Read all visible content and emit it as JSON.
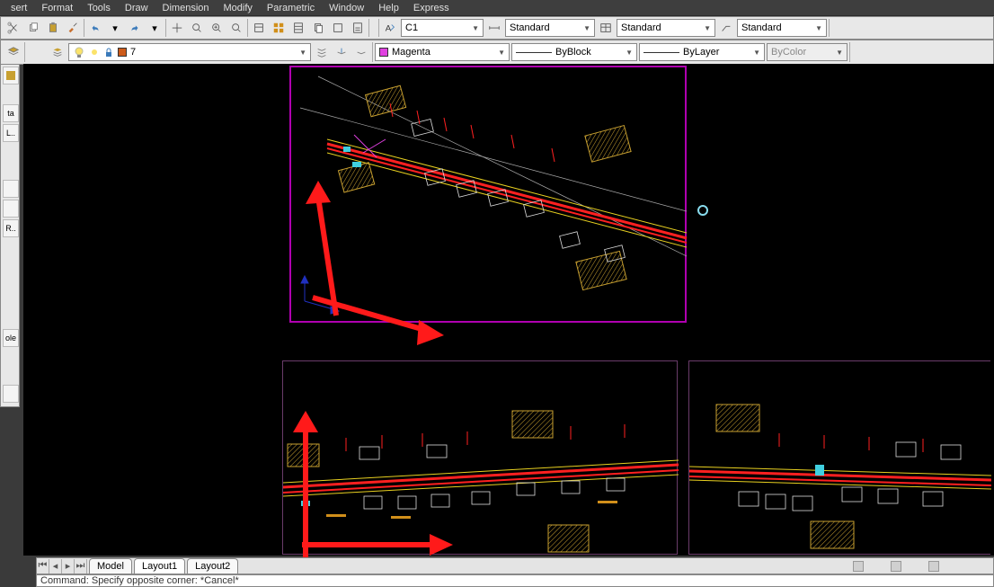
{
  "menu": {
    "items": [
      "sert",
      "Format",
      "Tools",
      "Draw",
      "Dimension",
      "Modify",
      "Parametric",
      "Window",
      "Help",
      "Express"
    ]
  },
  "toolbar1": {
    "text_style": "C1",
    "dim_style": "Standard",
    "table_style": "Standard",
    "mlead_style": "Standard"
  },
  "toolbar2": {
    "layer_name": "7",
    "color_name": "Magenta",
    "linetype": "ByBlock",
    "lineweight": "ByLayer",
    "plotstyle": "ByColor"
  },
  "side": {
    "items": [
      "",
      "ta",
      "L..",
      "",
      "",
      "R..",
      "",
      "ole",
      "",
      ""
    ]
  },
  "tabs": {
    "model": "Model",
    "layout1": "Layout1",
    "layout2": "Layout2"
  },
  "cmd": {
    "text": "Command: Specify opposite corner: *Cancel*"
  }
}
